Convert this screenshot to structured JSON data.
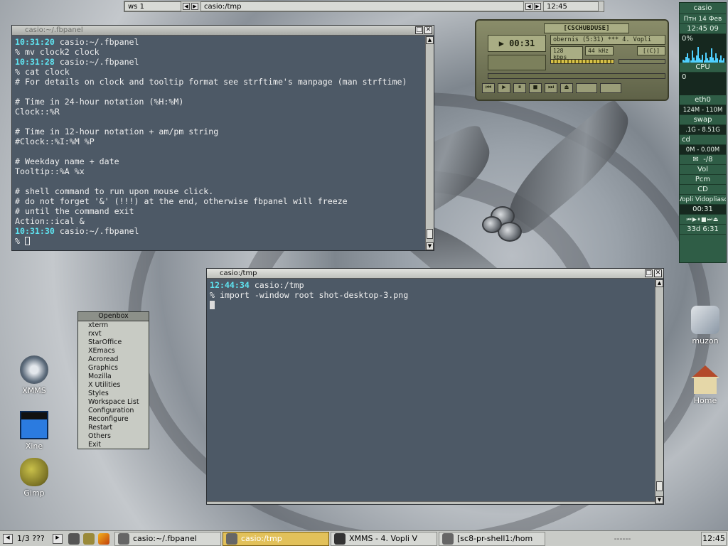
{
  "pager": {
    "workspace": "ws 1",
    "task": "casio:/tmp",
    "clock": "12:45"
  },
  "term1": {
    "title": "casio:~/.fbpanel",
    "lines": [
      {
        "ts": "10:31:20",
        "text": " casio:~/.fbpanel"
      },
      {
        "ts": "",
        "text": "% mv clock2 clock"
      },
      {
        "ts": "10:31:28",
        "text": " casio:~/.fbpanel"
      },
      {
        "ts": "",
        "text": "% cat clock"
      },
      {
        "ts": "",
        "text": "# For details on clock and tooltip format see strftime's manpage (man strftime)"
      },
      {
        "ts": "",
        "text": ""
      },
      {
        "ts": "",
        "text": "# Time in 24-hour notation (%H:%M)"
      },
      {
        "ts": "",
        "text": "Clock::%R"
      },
      {
        "ts": "",
        "text": ""
      },
      {
        "ts": "",
        "text": "# Time in 12-hour notation + am/pm string"
      },
      {
        "ts": "",
        "text": "#Clock::%I:%M %P"
      },
      {
        "ts": "",
        "text": ""
      },
      {
        "ts": "",
        "text": "# Weekday name + date"
      },
      {
        "ts": "",
        "text": "Tooltip::%A %x"
      },
      {
        "ts": "",
        "text": ""
      },
      {
        "ts": "",
        "text": "# shell command to run upon mouse click."
      },
      {
        "ts": "",
        "text": "# do not forget '&' (!!!) at the end, otherwise fbpanel will freeze"
      },
      {
        "ts": "",
        "text": "# until the command exit"
      },
      {
        "ts": "",
        "text": "Action::ical &"
      },
      {
        "ts": "10:31:30",
        "text": " casio:~/.fbpanel"
      }
    ],
    "prompt": "% "
  },
  "term2": {
    "title": "casio:/tmp",
    "ts": "12:44:34",
    "host": " casio:/tmp",
    "command": "% import -window root shot-desktop-3.png"
  },
  "xmms": {
    "brand": "[CSCHUBDUSE]",
    "time": "00:31",
    "title": "obernis (5:31)  *** 4. Vopli",
    "bitrate": "128 kbps",
    "freq": "44 kHz",
    "mode": "[(C)]"
  },
  "monitor": {
    "host": "casio",
    "date": "Птн 14 Фев",
    "time": "12:45 09",
    "cpu_pct": "0%",
    "cpu_label": "CPU",
    "cpu_value": "0",
    "net_label": "eth0",
    "net_stat": "124M - 110M",
    "swap_label": "swap",
    "swap_stat": ".1G - 8.51G",
    "cd_label": "cd",
    "cd_stat": "0M - 0.00M",
    "mail": "-/8",
    "vol": "Vol",
    "pcm": "Pcm",
    "cdvol": "CD",
    "track": "Vopli Vidopliasc",
    "track_time": "00:31",
    "uptime": "33d  6:31",
    "cpu_history": [
      0.15,
      0.1,
      0.3,
      0.45,
      0.2,
      0.1,
      0.6,
      0.25,
      0.1,
      0.35,
      0.8,
      0.2,
      0.15,
      0.4,
      0.1,
      0.5,
      0.2,
      0.1,
      0.3,
      0.7,
      0.25,
      0.1,
      0.45,
      0.2,
      0.15,
      0.35,
      0.1,
      0.2
    ]
  },
  "menu": {
    "title": "Openbox",
    "items": [
      "xterm",
      "rxvt",
      "StarOffice",
      "XEmacs",
      "Acroread",
      "Graphics",
      "Mozilla",
      "X Utilities",
      "Styles",
      "Workspace List",
      "Configuration",
      "Reconfigure",
      "Restart",
      "Others",
      "Exit"
    ]
  },
  "desktop": {
    "xmms": "XMMS",
    "xine": "Xine",
    "gimp": "Gimp",
    "muzon": "muzon",
    "home": "Home"
  },
  "taskbar": {
    "pager": "1/3 ???",
    "tasks": [
      "casio:~/.fbpanel",
      "casio:/tmp",
      "XMMS - 4. Vopli V",
      "[sc8-pr-shell1:/hom"
    ],
    "dashes": "------",
    "clock": "12:45"
  }
}
